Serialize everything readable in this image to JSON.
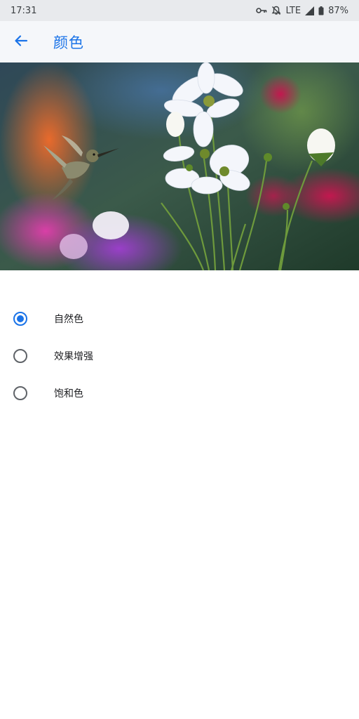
{
  "status_bar": {
    "time": "17:31",
    "network": "LTE",
    "battery": "87%",
    "icons": [
      "vpn-key-icon",
      "notifications-off-icon",
      "signal-icon",
      "battery-icon"
    ]
  },
  "app_bar": {
    "title": "颜色",
    "back_icon": "arrow-back-icon"
  },
  "preview_image": {
    "subject": "hummingbird and white cosmos flowers"
  },
  "color_options": [
    {
      "label": "自然色",
      "selected": true
    },
    {
      "label": "效果增强",
      "selected": false
    },
    {
      "label": "饱和色",
      "selected": false
    }
  ],
  "colors": {
    "accent": "#1a73e8",
    "radio_unselected": "#5f6368",
    "app_bar_bg": "#f5f7fa",
    "status_bar_bg": "#e8eaed"
  }
}
